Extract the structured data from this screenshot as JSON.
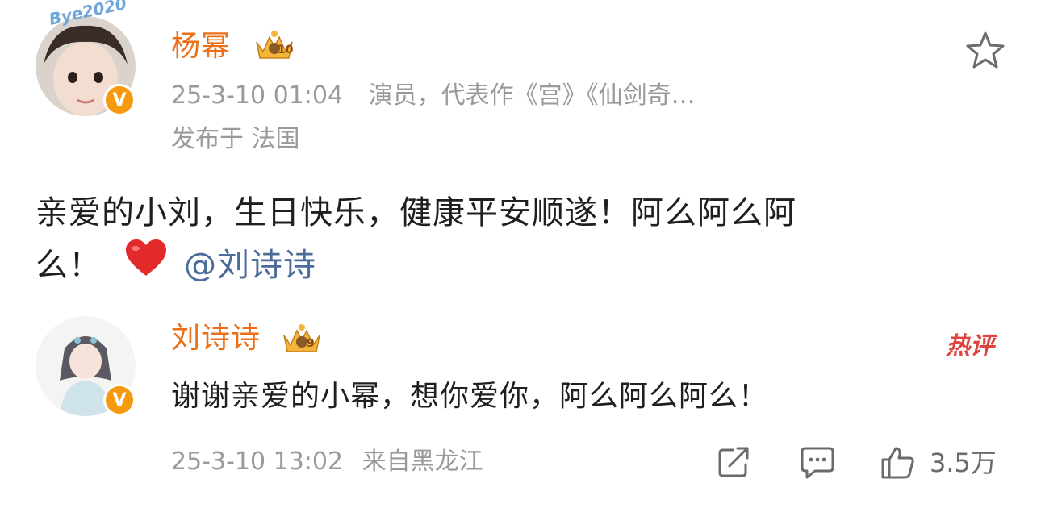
{
  "post": {
    "author": "杨幂",
    "level_badge": "10",
    "avatar_overlay_text": "Bye2020",
    "timestamp": "25-3-10 01:04",
    "description": "演员，代表作《宫》《仙剑奇…",
    "location": "发布于 法国",
    "text_line1": "亲爱的小刘，生日快乐，健康平安顺遂！阿么阿么阿",
    "text_line2_prefix": "么！",
    "mention": "@刘诗诗",
    "verified_mark": "V"
  },
  "reply": {
    "author": "刘诗诗",
    "level_badge": "9",
    "hot_label": "热评",
    "text": "谢谢亲爱的小幂，想你爱你，阿么阿么阿么！",
    "timestamp": "25-3-10 13:02",
    "source": "来自黑龙江",
    "like_count": "3.5万",
    "verified_mark": "V"
  },
  "icons": {
    "favorite": "star-icon",
    "share": "share-icon",
    "comment": "comment-icon",
    "like": "thumbs-up-icon",
    "emoji": "red-heart-icon"
  },
  "colors": {
    "name": "#ec6f18",
    "meta": "#9a9a9a",
    "mention": "#4b6b9a",
    "verified": "#f59a0e",
    "hot": "#e0433f"
  }
}
